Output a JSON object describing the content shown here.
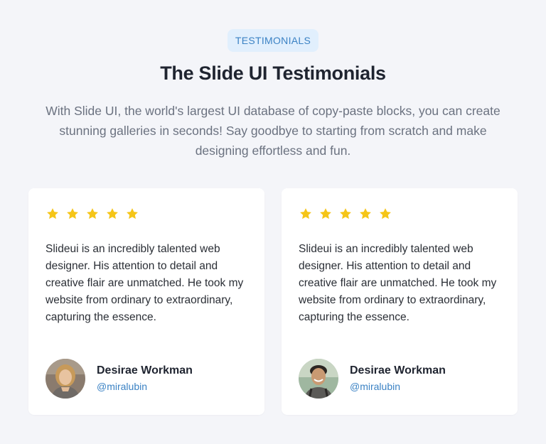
{
  "header": {
    "badge": "TESTIMONIALS",
    "title": "The Slide UI Testimonials",
    "subtitle": "With Slide UI, the world's largest UI database of copy-paste blocks, you can create stunning galleries in seconds! Say goodbye to starting from scratch and make designing effortless and fun."
  },
  "colors": {
    "accent": "#3b82c4",
    "badge_bg": "#e1effd",
    "star": "#f5c518",
    "page_bg": "#f4f5f9"
  },
  "testimonials": [
    {
      "rating": 5,
      "quote": "Slideui is an incredibly talented web designer. His attention to detail and creative flair are unmatched. He took my website from ordinary to extraordinary, capturing the essence.",
      "name": "Desirae Workman",
      "handle": "@miralubin",
      "avatar_icon": "avatar-photo"
    },
    {
      "rating": 5,
      "quote": "Slideui is an incredibly talented web designer. His attention to detail and creative flair are unmatched. He took my website from ordinary to extraordinary, capturing the essence.",
      "name": "Desirae Workman",
      "handle": "@miralubin",
      "avatar_icon": "avatar-photo"
    }
  ]
}
